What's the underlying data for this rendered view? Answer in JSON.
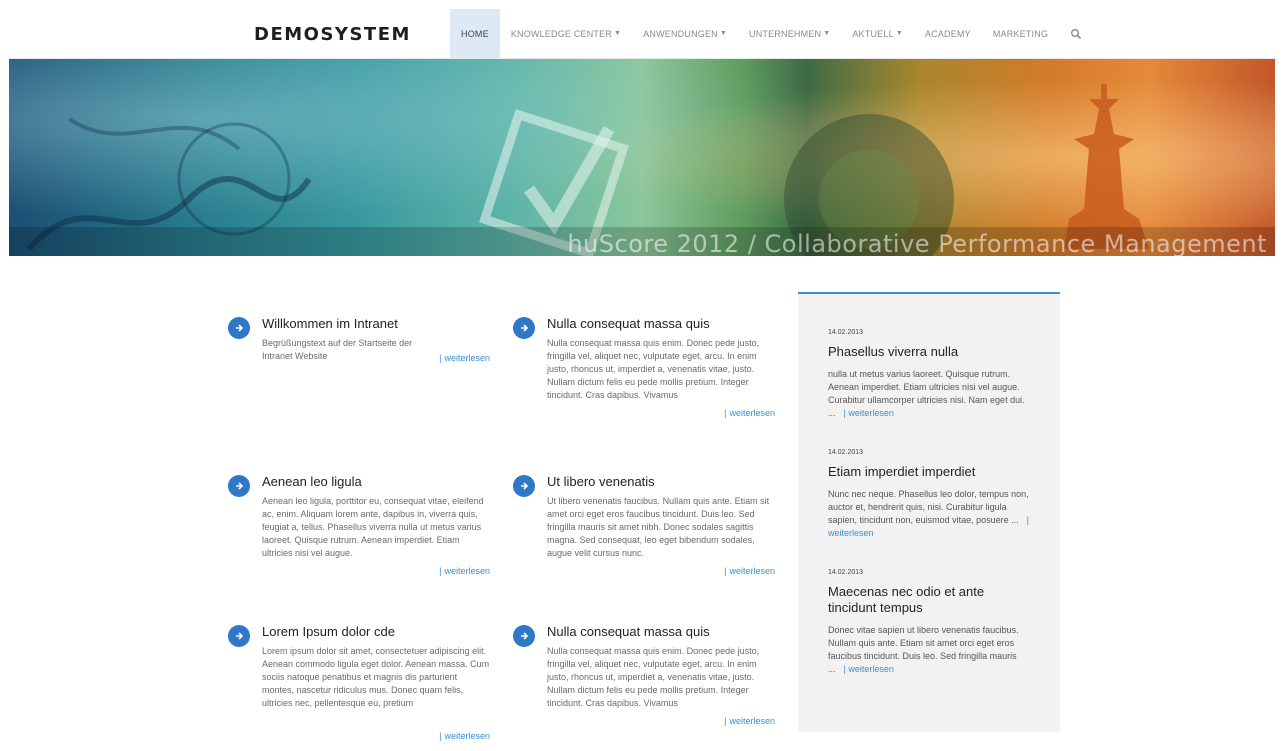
{
  "brand": "DEMOSYSTEM",
  "nav": [
    {
      "label": "HOME",
      "active": true,
      "dropdown": false
    },
    {
      "label": "KNOWLEDGE CENTER",
      "active": false,
      "dropdown": true
    },
    {
      "label": "ANWENDUNGEN",
      "active": false,
      "dropdown": true
    },
    {
      "label": "UNTERNEHMEN",
      "active": false,
      "dropdown": true
    },
    {
      "label": "AKTUELL",
      "active": false,
      "dropdown": true
    },
    {
      "label": "ACADEMY",
      "active": false,
      "dropdown": false
    },
    {
      "label": "MARKETING",
      "active": false,
      "dropdown": false
    }
  ],
  "banner": {
    "caption": "huScore 2012 / Collaborative Performance Management"
  },
  "articles": [
    {
      "title": "Willkommen im Intranet",
      "text": "Begrüßungstext auf der Startseite der Intranet Website",
      "link": "weiterlesen"
    },
    {
      "title": "Nulla consequat massa quis",
      "text": "Nulla consequat massa quis enim. Donec pede justo, fringilla vel, aliquet nec, vulputate eget, arcu. In enim justo, rhoncus ut, imperdiet a, venenatis vitae, justo. Nullam dictum felis eu pede mollis pretium. Integer tincidunt. Cras dapibus. Vivamus",
      "link": "weiterlesen"
    },
    {
      "title": "Aenean leo ligula",
      "text": "Aenean leo ligula, porttitor eu, consequat vitae, eleifend ac, enim. Aliquam lorem ante, dapibus in, viverra quis, feugiat a, tellus. Phasellus viverra nulla ut metus varius laoreet. Quisque rutrum. Aenean imperdiet. Etiam ultricies nisi vel augue.",
      "link": "weiterlesen"
    },
    {
      "title": "Ut libero venenatis",
      "text": "Ut libero venenatis faucibus. Nullam quis ante. Etiam sit amet orci eget eros faucibus tincidunt. Duis leo. Sed fringilla mauris sit amet nibh. Donec sodales sagittis magna. Sed consequat, leo eget bibendum sodales, augue velit cursus nunc.",
      "link": "weiterlesen"
    },
    {
      "title": "Lorem Ipsum dolor cde",
      "text": "Lorem ipsum dolor sit amet, consectetuer adipiscing elit. Aenean commodo ligula eget dolor. Aenean massa. Cum sociis natoque penatibus et magnis dis parturient montes, nascetur ridiculus mus. Donec quam felis, ultricies nec, pellentesque eu, pretium",
      "link": "weiterlesen"
    },
    {
      "title": "Nulla consequat massa quis",
      "text": "Nulla consequat massa quis enim. Donec pede justo, fringilla vel, aliquet nec, vulputate eget, arcu. In enim justo, rhoncus ut, imperdiet a, venenatis vitae, justo. Nullam dictum felis eu pede mollis pretium. Integer tincidunt. Cras dapibus. Vivamus",
      "link": "weiterlesen"
    }
  ],
  "news": [
    {
      "date": "14.02.2013",
      "title": "Phasellus viverra nulla",
      "text": "nulla ut metus varius laoreet. Quisque rutrum. Aenean imperdiet. Etiam ultricies nisi vel augue. Curabitur ullamcorper ultricies nisi. Nam eget dui. ...",
      "link": "| weiterlesen"
    },
    {
      "date": "14.02.2013",
      "title": "Etiam imperdiet imperdiet",
      "text": "Nunc nec neque. Phasellus leo dolor, tempus non, auctor et, hendrerit quis, nisi. Curabitur ligula sapien, tincidunt non, euismod vitae, posuere ...",
      "link": "| weiterlesen"
    },
    {
      "date": "14.02.2013",
      "title": "Maecenas nec odio et ante tincidunt tempus",
      "text": "Donec vitae sapien ut libero venenatis faucibus. Nullam quis ante. Etiam sit amet orci eget eros faucibus tincidunt. Duis leo. Sed fringilla mauris ...",
      "link": "| weiterlesen"
    }
  ],
  "colors": {
    "accent": "#2e78c7",
    "link": "#3a8fd6",
    "sidebar_bg": "#f2f2f2"
  }
}
